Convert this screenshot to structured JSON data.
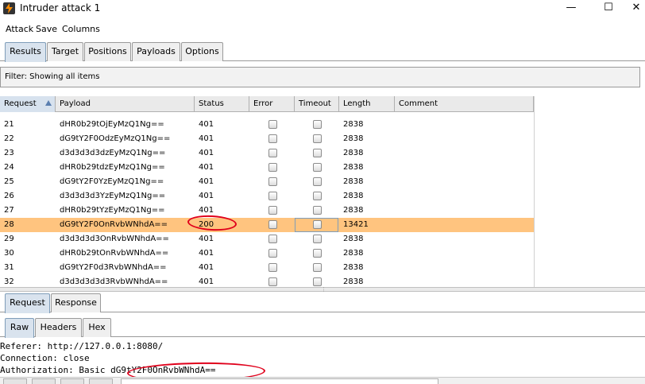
{
  "window": {
    "title": "Intruder attack 1",
    "minimize": "—",
    "maximize": "☐",
    "close": "✕",
    "icon": "burp-lightning-icon"
  },
  "menu": [
    "Attack",
    "Save",
    "Columns"
  ],
  "tabs": [
    {
      "label": "Results",
      "active": true
    },
    {
      "label": "Target",
      "active": false
    },
    {
      "label": "Positions",
      "active": false
    },
    {
      "label": "Payloads",
      "active": false
    },
    {
      "label": "Options",
      "active": false
    }
  ],
  "filter": {
    "text": "Filter:  Showing all items"
  },
  "table": {
    "columns": [
      "Request",
      "Payload",
      "Status",
      "Error",
      "Timeout",
      "Length",
      "Comment"
    ],
    "sorted_column": "Request",
    "rows": [
      {
        "request": "21",
        "payload": "dHR0b29tOjEyMzQ1Ng==",
        "status": "401",
        "error": false,
        "timeout": false,
        "length": "2838",
        "comment": "",
        "selected": false
      },
      {
        "request": "22",
        "payload": "dG9tY2F0OdzEyMzQ1Ng==",
        "status": "401",
        "error": false,
        "timeout": false,
        "length": "2838",
        "comment": "",
        "selected": false
      },
      {
        "request": "23",
        "payload": "d3d3d3d3dzEyMzQ1Ng==",
        "status": "401",
        "error": false,
        "timeout": false,
        "length": "2838",
        "comment": "",
        "selected": false
      },
      {
        "request": "24",
        "payload": "dHR0b29tdzEyMzQ1Ng==",
        "status": "401",
        "error": false,
        "timeout": false,
        "length": "2838",
        "comment": "",
        "selected": false
      },
      {
        "request": "25",
        "payload": "dG9tY2F0YzEyMzQ1Ng==",
        "status": "401",
        "error": false,
        "timeout": false,
        "length": "2838",
        "comment": "",
        "selected": false
      },
      {
        "request": "26",
        "payload": "d3d3d3d3YzEyMzQ1Ng==",
        "status": "401",
        "error": false,
        "timeout": false,
        "length": "2838",
        "comment": "",
        "selected": false
      },
      {
        "request": "27",
        "payload": "dHR0b29tYzEyMzQ1Ng==",
        "status": "401",
        "error": false,
        "timeout": false,
        "length": "2838",
        "comment": "",
        "selected": false
      },
      {
        "request": "28",
        "payload": "dG9tY2F0OnRvbWNhdA==",
        "status": "200",
        "error": false,
        "timeout": false,
        "length": "13421",
        "comment": "",
        "selected": true
      },
      {
        "request": "29",
        "payload": "d3d3d3d3OnRvbWNhdA==",
        "status": "401",
        "error": false,
        "timeout": false,
        "length": "2838",
        "comment": "",
        "selected": false
      },
      {
        "request": "30",
        "payload": "dHR0b29tOnRvbWNhdA==",
        "status": "401",
        "error": false,
        "timeout": false,
        "length": "2838",
        "comment": "",
        "selected": false
      },
      {
        "request": "31",
        "payload": "dG9tY2F0d3RvbWNhdA==",
        "status": "401",
        "error": false,
        "timeout": false,
        "length": "2838",
        "comment": "",
        "selected": false
      },
      {
        "request": "32",
        "payload": "d3d3d3d3d3RvbWNhdA==",
        "status": "401",
        "error": false,
        "timeout": false,
        "length": "2838",
        "comment": "",
        "selected": false
      }
    ]
  },
  "detail_tabs": [
    {
      "label": "Request",
      "active": true
    },
    {
      "label": "Response",
      "active": false
    }
  ],
  "view_tabs": [
    {
      "label": "Raw",
      "active": true
    },
    {
      "label": "Headers",
      "active": false
    },
    {
      "label": "Hex",
      "active": false
    }
  ],
  "editor": {
    "lines": [
      "Referer: http://127.0.0.1:8080/",
      "Connection: close",
      "Authorization: Basic dG9tY2F0OnRvbWNhdA=="
    ]
  },
  "colors": {
    "selected_row": "#ffc47f",
    "annotation": "#e0001b",
    "active_tab": "#d9e3ee"
  }
}
